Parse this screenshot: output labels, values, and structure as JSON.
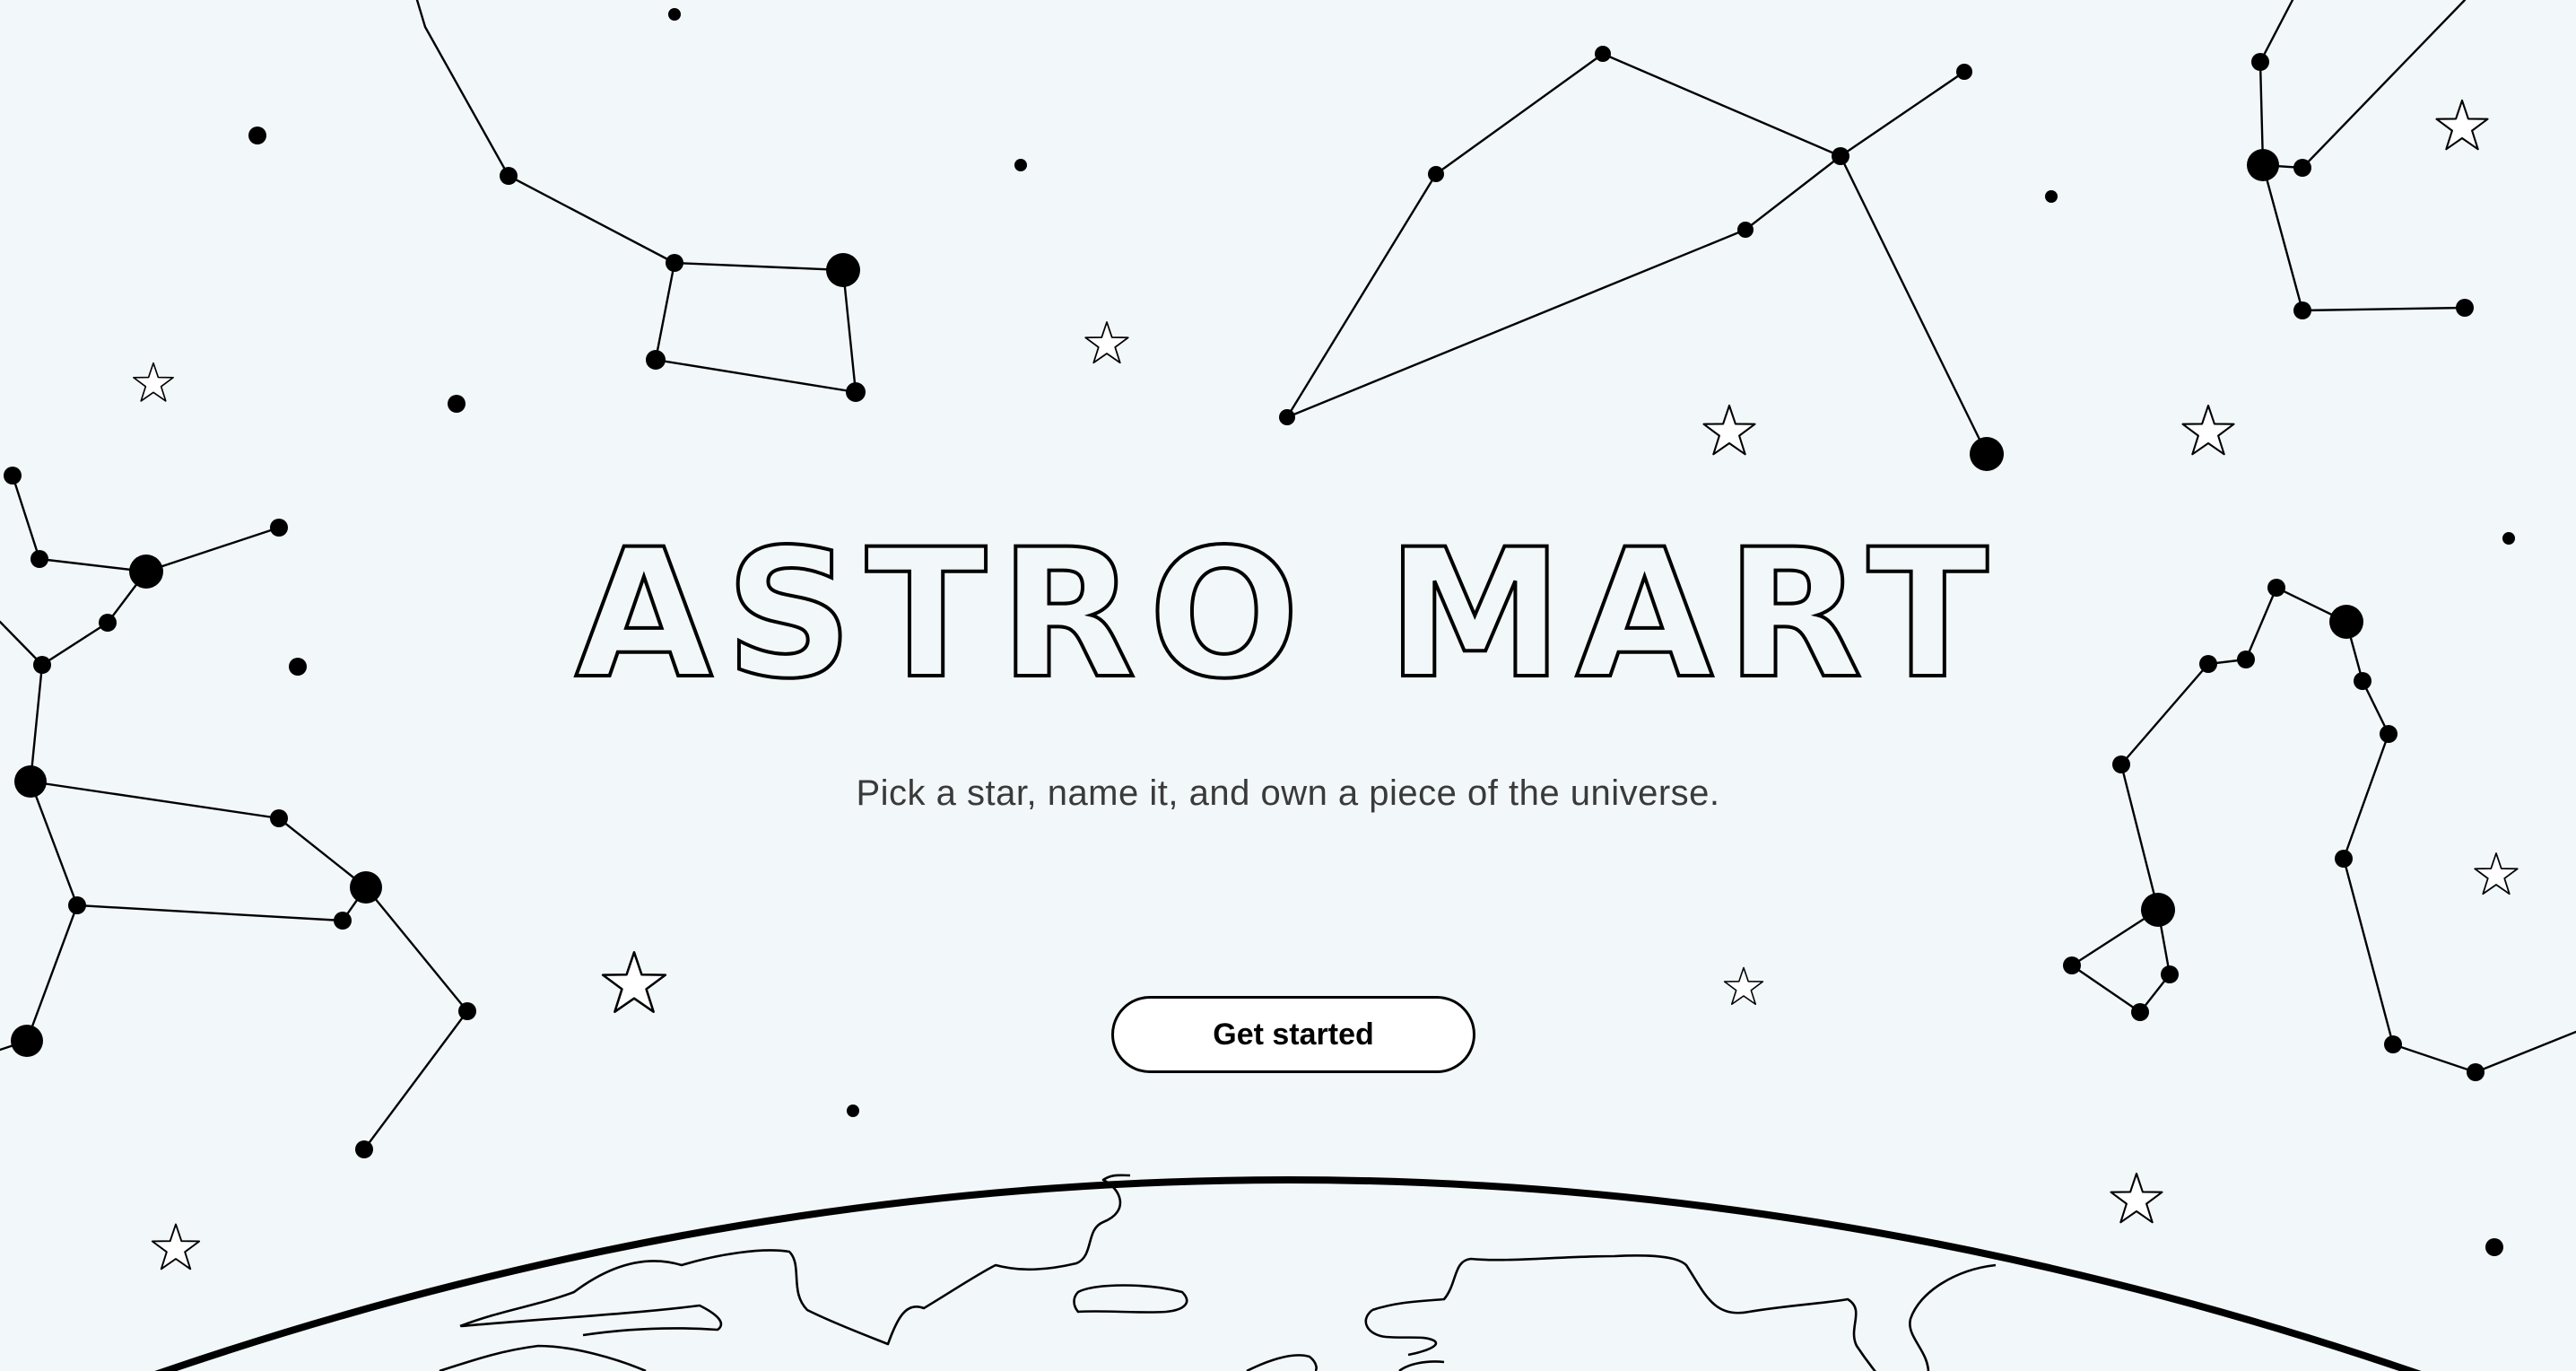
{
  "hero": {
    "title": "ASTRO MART",
    "subtitle": "Pick a star, name it, and own a piece of the universe.",
    "cta_label": "Get started"
  },
  "colors": {
    "background": "#f2f7f9",
    "ink": "#000000",
    "button_fill": "#ffffff"
  }
}
